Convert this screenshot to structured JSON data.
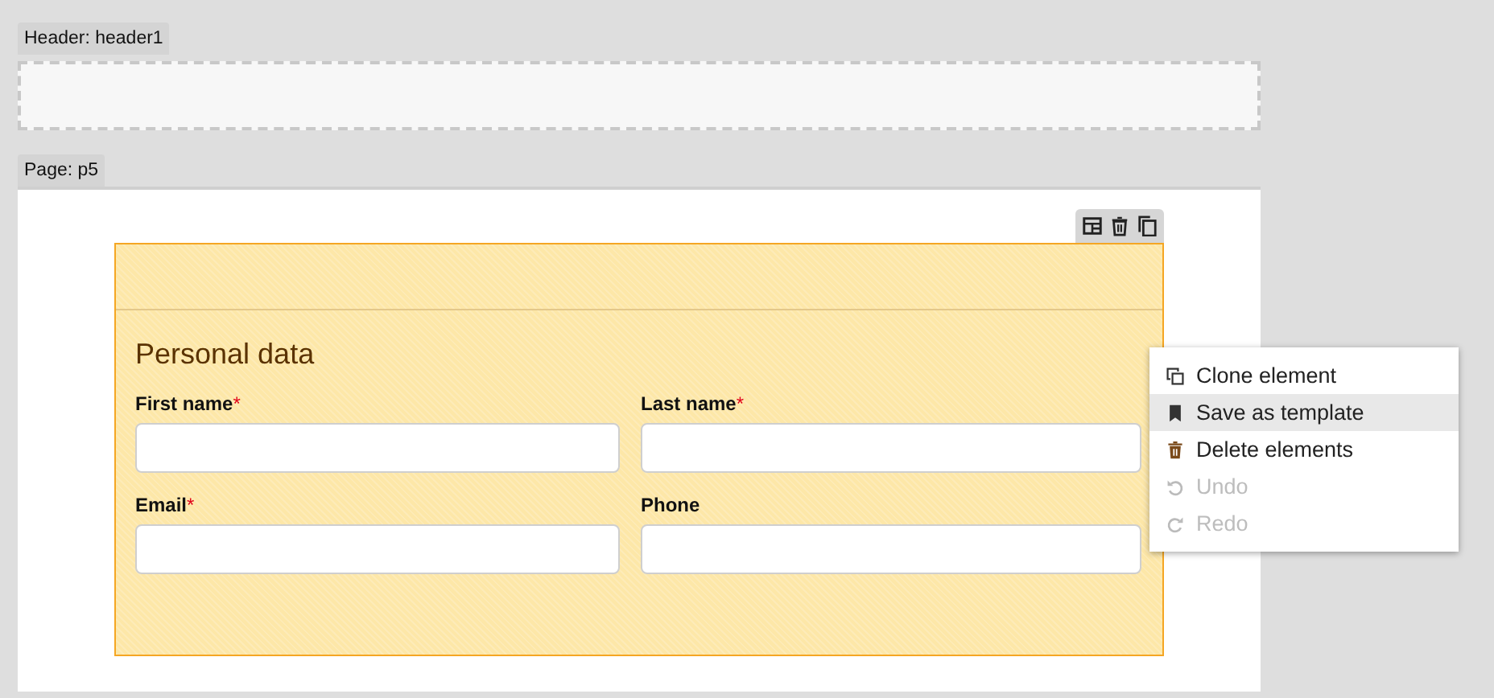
{
  "header": {
    "tag": "Header: header1"
  },
  "page": {
    "tag": "Page: p5",
    "form": {
      "title": "Personal data",
      "fields": [
        {
          "label": "First name",
          "required_mark": "*"
        },
        {
          "label": "Last name",
          "required_mark": "*"
        },
        {
          "label": "Email",
          "required_mark": "*"
        },
        {
          "label": "Phone"
        }
      ]
    }
  },
  "context_menu": {
    "items": [
      {
        "kind": "clone",
        "label": "Clone element",
        "selected": false,
        "disabled": false
      },
      {
        "kind": "bookmark",
        "label": "Save as template",
        "selected": true,
        "disabled": false
      },
      {
        "kind": "trash",
        "label": "Delete elements",
        "selected": false,
        "disabled": false
      },
      {
        "kind": "undo",
        "label": "Undo",
        "selected": false,
        "disabled": true
      },
      {
        "kind": "redo",
        "label": "Redo",
        "selected": false,
        "disabled": true
      }
    ]
  }
}
